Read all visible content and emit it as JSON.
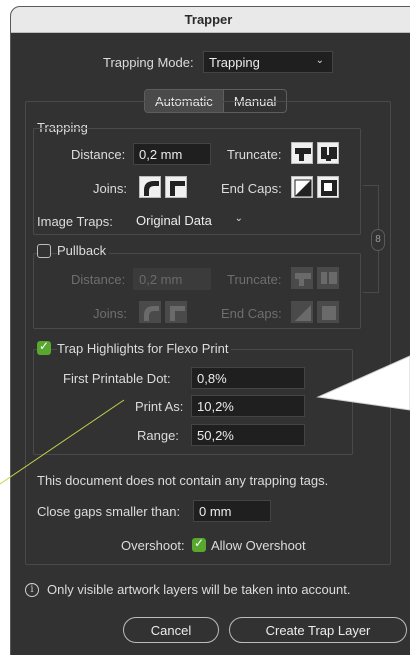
{
  "window": {
    "title": "Trapper"
  },
  "mode": {
    "label": "Trapping Mode:",
    "value": "Trapping"
  },
  "tabs": {
    "automatic": "Automatic",
    "manual": "Manual",
    "selected": "Automatic"
  },
  "trapping": {
    "section_label": "Trapping",
    "distance_label": "Distance:",
    "distance_value": "0,2 mm",
    "truncate_label": "Truncate:",
    "joins_label": "Joins:",
    "endcaps_label": "End Caps:",
    "image_traps_label": "Image Traps:",
    "image_traps_value": "Original Data"
  },
  "pullback": {
    "label": "Pullback",
    "checked": false,
    "distance_label": "Distance:",
    "distance_value": "0,2 mm",
    "truncate_label": "Truncate:",
    "joins_label": "Joins:",
    "endcaps_label": "End Caps:"
  },
  "flexo": {
    "label": "Trap Highlights for Flexo Print",
    "checked": true,
    "first_dot_label": "First Printable Dot:",
    "first_dot_value": "0,8%",
    "print_as_label": "Print As:",
    "print_as_value": "10,2%",
    "range_label": "Range:",
    "range_value": "50,2%"
  },
  "status_text": "This document does not contain any trapping tags.",
  "close_gaps": {
    "label": "Close gaps smaller than:",
    "value": "0 mm"
  },
  "overshoot": {
    "label": "Overshoot:",
    "checkbox_label": "Allow Overshoot",
    "checked": true
  },
  "info": {
    "icon": "info-icon",
    "text": "Only visible artwork layers will be taken into account."
  },
  "buttons": {
    "cancel": "Cancel",
    "create": "Create Trap Layer"
  },
  "colors": {
    "window_bg": "#323232",
    "check_green": "#58a82f",
    "callout_line": "#c8d24a"
  }
}
